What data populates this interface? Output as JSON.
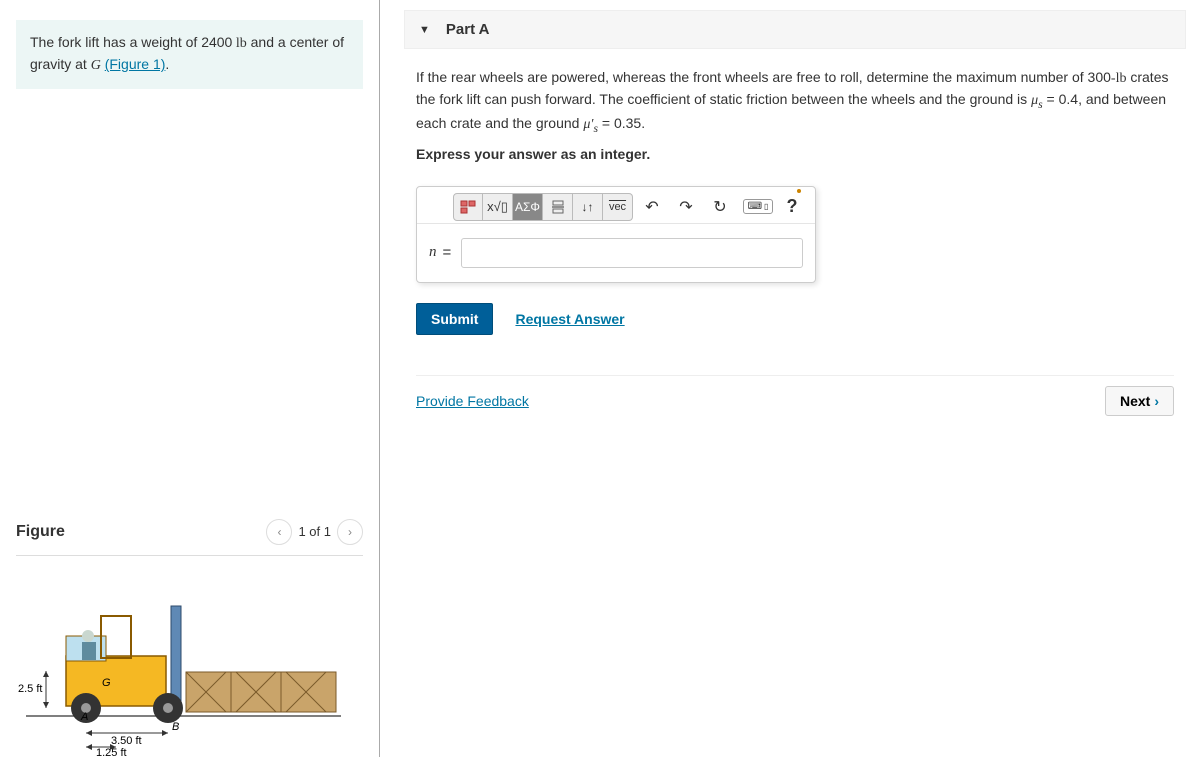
{
  "problem": {
    "pre_text": "The fork lift has a weight of ",
    "weight": "2400",
    "weight_unit": " lb",
    "mid_text": " and a center of gravity at ",
    "cg_var": "G",
    "figure_link": "(Figure 1)",
    "suffix": "."
  },
  "figure": {
    "title": "Figure",
    "pager": "1 of 1",
    "labels": {
      "h": "2.5 ft",
      "a": "A",
      "b": "B",
      "d1": "3.50 ft",
      "d2": "1.25 ft",
      "g": "G"
    }
  },
  "partA": {
    "title": "Part A",
    "q_pre": "If the rear wheels are powered, whereas the front wheels are free to roll, determine the maximum number of ",
    "q_crate_w": "300",
    "q_crate_unit": "-lb",
    "q_mid": " crates the fork lift can push forward. The coefficient of static friction between the wheels and the ground is ",
    "mu1_sym": "μ",
    "mu1_sub": "s",
    "mu1_val": " = 0.4",
    "q_mid2": ", and between each crate and the ground ",
    "mu2_sym": "μ",
    "mu2_sub": "s",
    "mu2_prime": "′",
    "mu2_val": " = 0.35",
    "q_end": ".",
    "instruct": "Express your answer as an integer.",
    "var": "n",
    "eq": "="
  },
  "buttons": {
    "submit": "Submit",
    "request": "Request Answer",
    "feedback": "Provide Feedback",
    "next": "Next"
  },
  "tools": {
    "templates": "",
    "sqrt": "",
    "greek": "ΑΣΦ",
    "frac": "",
    "updown": "↓↑",
    "vec": "vec",
    "undo": "↶",
    "redo": "↷",
    "reset": "↻",
    "help": "?"
  }
}
